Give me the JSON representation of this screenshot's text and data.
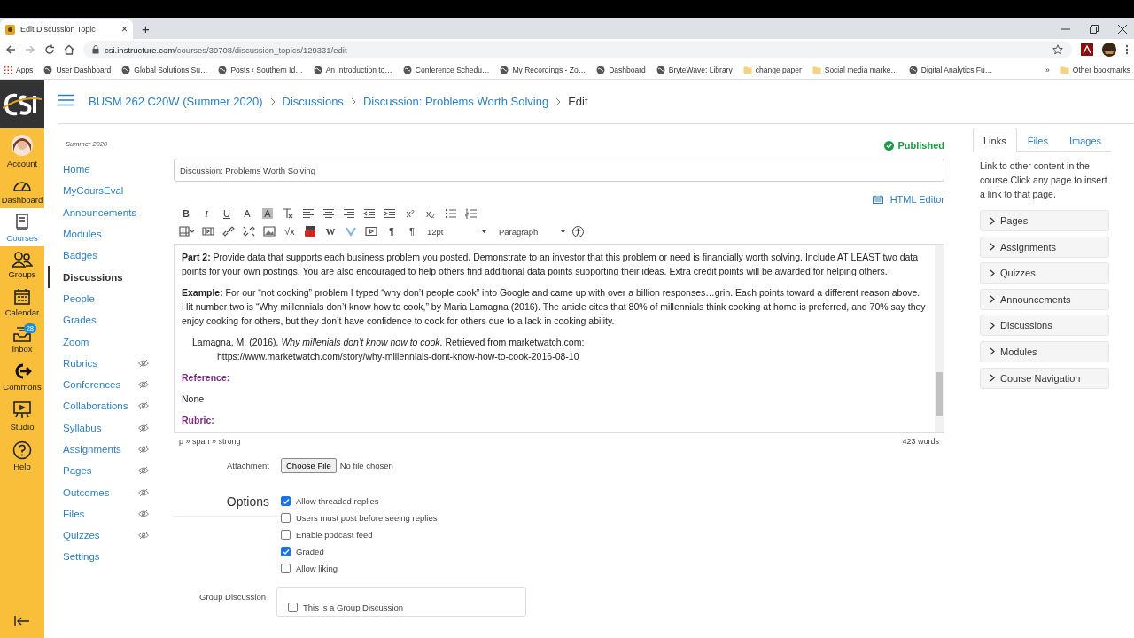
{
  "browser": {
    "tab_title": "Edit Discussion Topic",
    "tab_close": "×",
    "new_tab": "+",
    "url_host": "csi.instructure.com",
    "url_path": "/courses/39708/discussion_topics/129331/edit",
    "bookmarks": [
      {
        "kind": "apps",
        "label": "Apps"
      },
      {
        "kind": "site",
        "label": "User Dashboard"
      },
      {
        "kind": "site",
        "label": "Global Solutions Su…"
      },
      {
        "kind": "site",
        "label": "Posts ‹ Southern Id…"
      },
      {
        "kind": "site",
        "label": "An Introduction to…"
      },
      {
        "kind": "site",
        "label": "Conference Schedu…"
      },
      {
        "kind": "site",
        "label": "My Recordings - Zo…"
      },
      {
        "kind": "site",
        "label": "Dashboard"
      },
      {
        "kind": "site",
        "label": "BryteWave: Library"
      },
      {
        "kind": "folder",
        "label": "change paper"
      },
      {
        "kind": "folder",
        "label": "Social media marke…"
      },
      {
        "kind": "site",
        "label": "Digital Analytics Fu…"
      }
    ],
    "more": "»",
    "other_bookmarks": "Other bookmarks"
  },
  "global_nav": [
    {
      "label": "Account",
      "selected": false
    },
    {
      "label": "Dashboard",
      "selected": false
    },
    {
      "label": "Courses",
      "selected": true
    },
    {
      "label": "Groups",
      "selected": false
    },
    {
      "label": "Calendar",
      "selected": false
    },
    {
      "label": "Inbox",
      "selected": false,
      "badge": "28"
    },
    {
      "label": "Commons",
      "selected": false
    },
    {
      "label": "Studio",
      "selected": false
    },
    {
      "label": "Help",
      "selected": false
    }
  ],
  "breadcrumb": [
    "BUSM 262 C20W (Summer 2020)",
    "Discussions",
    "Discussion: Problems Worth Solving",
    "Edit"
  ],
  "course_nav": {
    "term": "Summer 2020",
    "items": [
      {
        "label": "Home",
        "selected": false,
        "hidden": false
      },
      {
        "label": "MyCoursEval",
        "selected": false,
        "hidden": false
      },
      {
        "label": "Announcements",
        "selected": false,
        "hidden": false
      },
      {
        "label": "Modules",
        "selected": false,
        "hidden": false
      },
      {
        "label": "Badges",
        "selected": false,
        "hidden": false
      },
      {
        "label": "Discussions",
        "selected": true,
        "hidden": false
      },
      {
        "label": "People",
        "selected": false,
        "hidden": false
      },
      {
        "label": "Grades",
        "selected": false,
        "hidden": false
      },
      {
        "label": "Zoom",
        "selected": false,
        "hidden": false
      },
      {
        "label": "Rubrics",
        "selected": false,
        "hidden": true
      },
      {
        "label": "Conferences",
        "selected": false,
        "hidden": true
      },
      {
        "label": "Collaborations",
        "selected": false,
        "hidden": true
      },
      {
        "label": "Syllabus",
        "selected": false,
        "hidden": true
      },
      {
        "label": "Assignments",
        "selected": false,
        "hidden": true
      },
      {
        "label": "Pages",
        "selected": false,
        "hidden": true
      },
      {
        "label": "Outcomes",
        "selected": false,
        "hidden": true
      },
      {
        "label": "Files",
        "selected": false,
        "hidden": true
      },
      {
        "label": "Quizzes",
        "selected": false,
        "hidden": true
      },
      {
        "label": "Settings",
        "selected": false,
        "hidden": false
      }
    ]
  },
  "editor": {
    "status": "Published",
    "title_value": "Discussion: Problems Worth Solving",
    "html_editor": "HTML Editor",
    "toolbar_row_1": [
      {
        "kind": "bold",
        "label": "B"
      },
      {
        "kind": "italic",
        "label": "I"
      },
      {
        "kind": "underline",
        "label": "U"
      },
      {
        "kind": "text-color",
        "label": "A"
      },
      {
        "kind": "highlight",
        "label": "A"
      },
      {
        "kind": "clear-format"
      },
      {
        "kind": "align-left"
      },
      {
        "kind": "align-center"
      },
      {
        "kind": "align-right"
      },
      {
        "kind": "outdent"
      },
      {
        "kind": "indent"
      },
      {
        "kind": "superscript",
        "label": "x²"
      },
      {
        "kind": "subscript",
        "label": "x₂"
      },
      {
        "kind": "bullet-list"
      },
      {
        "kind": "numbered-list"
      }
    ],
    "toolbar_row_2": [
      {
        "kind": "table"
      },
      {
        "kind": "media"
      },
      {
        "kind": "link"
      },
      {
        "kind": "unlink"
      },
      {
        "kind": "image"
      },
      {
        "kind": "equation",
        "label": "√x"
      },
      {
        "kind": "video"
      },
      {
        "kind": "wiki",
        "label": "W"
      },
      {
        "kind": "vimeo"
      },
      {
        "kind": "embed"
      },
      {
        "kind": "ltr",
        "label": "¶"
      },
      {
        "kind": "rtl",
        "label": "¶"
      }
    ],
    "font_size": "12pt",
    "block_format": "Paragraph",
    "content": [
      {
        "kind": "paragraph",
        "text": "**Part 2:** Provide data that supports each business problem you posted. Demonstrate to an investor that this problem or need is financially worth solving. Include AT LEAST two data points for your own postings. You are also encouraged to help others find additional data points supporting their ideas. Extra credit points will be awarded for helping others."
      },
      {
        "kind": "paragraph",
        "text": "**Example:** For our “not cooking” problem I typed “why don’t people cook” into Google and came up with over a billion responses…grin. Each points toward a different reason above. Hit number two is “Why millennials don’t know how to cook,” by Maria Lamagna (2016). The article cites that 80% of millennials think cooking at home is preferred, and 70% say they enjoy cooking for others, but they don’t have confidence to cook for others due to a lack in cooking ability."
      },
      {
        "kind": "citation",
        "text": "Lamagna, M. (2016). *Why millenials don’t know how to cook*. Retrieved from marketwatch.com:",
        "url": "https://www.marketwatch.com/story/why-millennials-dont-know-how-to-cook-2016-08-10"
      },
      {
        "kind": "heading",
        "text": "Reference:"
      },
      {
        "kind": "paragraph",
        "text": "None"
      },
      {
        "kind": "heading",
        "text": "Rubric:"
      }
    ],
    "path": "p » span » strong",
    "word_count": "423 words"
  },
  "attachment": {
    "label": "Attachment",
    "button": "Choose File",
    "status": "No file chosen"
  },
  "options": {
    "title": "Options",
    "items": [
      {
        "label": "Allow threaded replies",
        "checked": true
      },
      {
        "label": "Users must post before seeing replies",
        "checked": false
      },
      {
        "label": "Enable podcast feed",
        "checked": false
      },
      {
        "label": "Graded",
        "checked": true
      },
      {
        "label": "Allow liking",
        "checked": false
      }
    ]
  },
  "group_discussion": {
    "label": "Group Discussion",
    "items": [
      {
        "label": "This is a Group Discussion",
        "checked": false
      }
    ]
  },
  "content_panel": {
    "tabs": [
      {
        "label": "Links",
        "selected": true
      },
      {
        "label": "Files",
        "selected": false
      },
      {
        "label": "Images",
        "selected": false
      }
    ],
    "description": "Link to other content in the course.Click any page to insert a link to that page.",
    "sections": [
      {
        "label": "Pages"
      },
      {
        "label": "Assignments"
      },
      {
        "label": "Quizzes"
      },
      {
        "label": "Announcements"
      },
      {
        "label": "Discussions"
      },
      {
        "label": "Modules"
      },
      {
        "label": "Course Navigation"
      }
    ]
  }
}
